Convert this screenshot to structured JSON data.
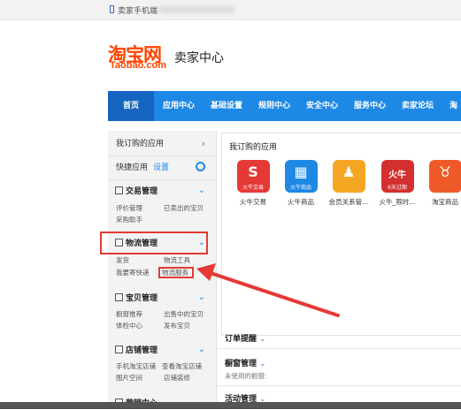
{
  "browser": {
    "mobile_link": "卖家手机端"
  },
  "logo": {
    "name": "淘宝网",
    "domain": "Taobao.com",
    "site_name": "卖家中心"
  },
  "nav": {
    "items": [
      {
        "label": "首页",
        "active": true
      },
      {
        "label": "应用中心"
      },
      {
        "label": "基础设置"
      },
      {
        "label": "规则中心"
      },
      {
        "label": "安全中心"
      },
      {
        "label": "服务中心"
      },
      {
        "label": "卖家论坛"
      },
      {
        "label": "淘宝"
      }
    ]
  },
  "sidebar": {
    "my_apps": "我订购的应用",
    "quick_apps": "快捷应用",
    "settings": "设置",
    "sections": [
      {
        "title": "交易管理",
        "links": [
          "评价管理",
          "已卖出的宝贝",
          "采购助手"
        ]
      },
      {
        "title": "物流管理",
        "links": [
          "发货",
          "物流工具",
          "我要寄快递",
          "物流服务"
        ]
      },
      {
        "title": "宝贝管理",
        "links": [
          "橱窗推荐",
          "出售中的宝贝",
          "体检中心",
          "发布宝贝"
        ]
      },
      {
        "title": "店铺管理",
        "links": [
          "手机淘宝店铺",
          "查看淘宝店铺",
          "图片空间",
          "店铺装修"
        ]
      },
      {
        "title": "营销中心",
        "links": []
      }
    ]
  },
  "apps": {
    "title": "我订购的应用",
    "items": [
      {
        "name": "火牛交易",
        "caption": "火牛交易",
        "color": "#e53935"
      },
      {
        "name": "火牛商品",
        "caption": "火牛商品",
        "color": "#1e88e5"
      },
      {
        "name": "会员关系管...",
        "caption": "",
        "color": "#f5a623"
      },
      {
        "name": "火牛_限时...",
        "caption": "6天过期",
        "badge": "火牛",
        "color": "#d32f2f"
      },
      {
        "name": "淘宝商品",
        "caption": "",
        "color": "#ef5a28"
      }
    ]
  },
  "panels": {
    "order_reminder": "订单提醒",
    "window_mgmt": "橱窗管理",
    "unused_window": "未使用的橱窗:",
    "activity_mgmt": "活动管理"
  },
  "colors": {
    "accent": "#1e88e5",
    "brand": "#ff4400",
    "highlight": "#e53935"
  }
}
